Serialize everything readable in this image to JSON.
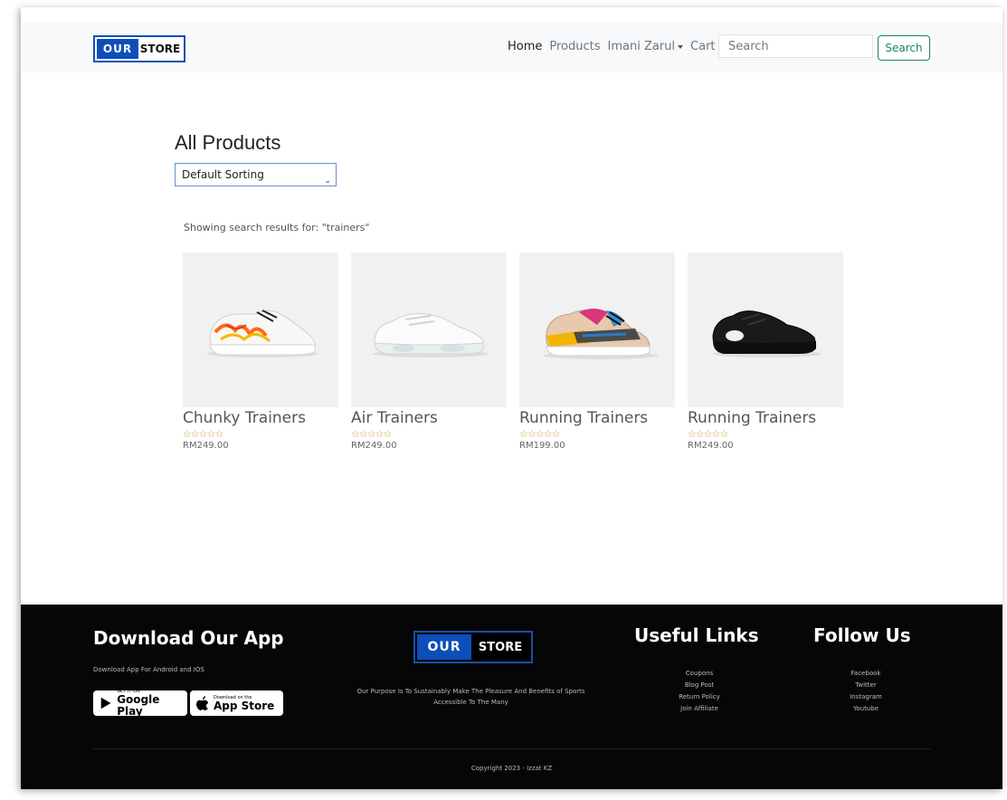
{
  "nav": {
    "logo_our": "OUR",
    "logo_store": "STORE",
    "links": [
      "Home",
      "Products",
      "Imani Zarul",
      "Cart"
    ],
    "search_placeholder": "Search",
    "search_button": "Search"
  },
  "main": {
    "title": "All Products",
    "sort_selected": "Default Sorting",
    "results_text": "Showing search results for: \"trainers\"",
    "products": [
      {
        "name": "Chunky Trainers",
        "price": "RM249.00",
        "rating": 0,
        "icon": "white-orange-graffiti-sneaker"
      },
      {
        "name": "Air Trainers",
        "price": "RM249.00",
        "rating": 0,
        "icon": "white-air-sneaker"
      },
      {
        "name": "Running Trainers",
        "price": "RM199.00",
        "rating": 0,
        "icon": "multicolor-running-sneaker"
      },
      {
        "name": "Running Trainers",
        "price": "RM249.00",
        "rating": 0,
        "icon": "black-running-sneaker"
      }
    ]
  },
  "footer": {
    "app_title": "Download Our App",
    "app_subtitle": "Download App For Android and IOS",
    "google_small": "GET IT ON",
    "google_big": "Google Play",
    "apple_small": "Download on the",
    "apple_big": "App Store",
    "logo_our": "OUR",
    "logo_store": "STORE",
    "purpose": "Our Purpose Is To Sustainably Make The Pleasure And Benefits of Sports Accessible To The Many",
    "useful_title": "Useful Links",
    "useful_links": [
      "Coupons",
      "Blog Post",
      "Return Policy",
      "Join Affiliate"
    ],
    "follow_title": "Follow Us",
    "follow_links": [
      "Facebook",
      "Twitter",
      "Instagram",
      "Youtube"
    ],
    "copyright": "Copyright 2023 - Izzat KZ"
  },
  "colors": {
    "brand_blue": "#0d4fb8",
    "search_green": "#198754",
    "footer_bg": "#060606",
    "star_gold": "#c9962b"
  }
}
